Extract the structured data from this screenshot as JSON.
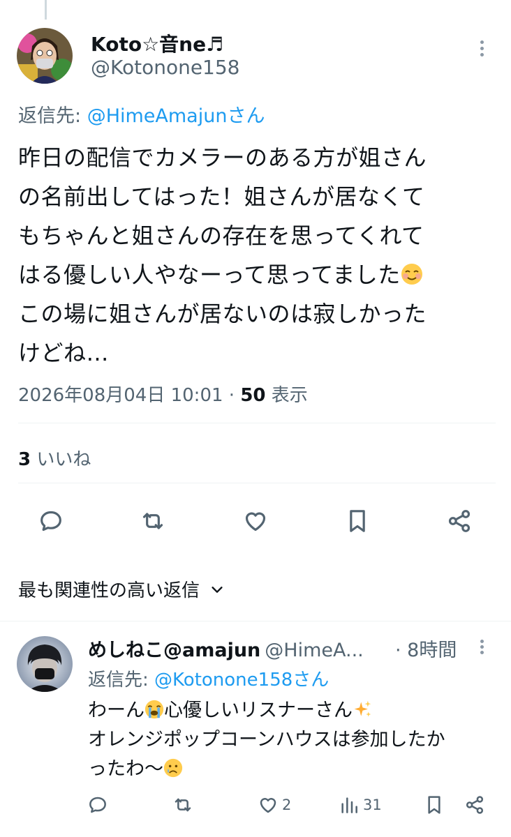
{
  "tweet": {
    "author_name": "Koto☆音ne♬",
    "author_handle": "@Kotonone158",
    "reply_prefix": "返信先: ",
    "reply_mention": "@HimeAmajunさん",
    "text_lines": [
      "昨日の配信でカメラーのある方が姐さん",
      "の名前出してはった！姐さんが居なくて",
      "もちゃんと姐さんの存在を思ってくれて",
      "はる優しい人やなーって思ってました",
      "この場に姐さんが居ないのは寂しかった",
      "けどね…"
    ],
    "timestamp": "2026年08月04日 10:01",
    "separator": " · ",
    "views_count": "50",
    "views_label": " 表示",
    "likes_count": "3",
    "likes_label": " いいね"
  },
  "actions": [
    "reply-icon",
    "retweet-icon",
    "like-icon",
    "bookmark-icon",
    "share-icon"
  ],
  "sort": {
    "label": "最も関連性の高い返信"
  },
  "reply": {
    "author_name": "めしねこ@amajun",
    "author_handle": "@HimeA...",
    "time": "· 8時間",
    "reply_prefix": "返信先: ",
    "reply_mention": "@Kotonone158さん",
    "line1_a": "わーん",
    "line1_b": "心優しいリスナーさん",
    "line2": "オレンジポップコーンハウスは参加したか",
    "line3": "ったわ〜",
    "likes": "2",
    "views": "31"
  },
  "colors": {
    "accent": "#1d9bf0",
    "secondary": "#536471",
    "text": "#0f1419"
  }
}
